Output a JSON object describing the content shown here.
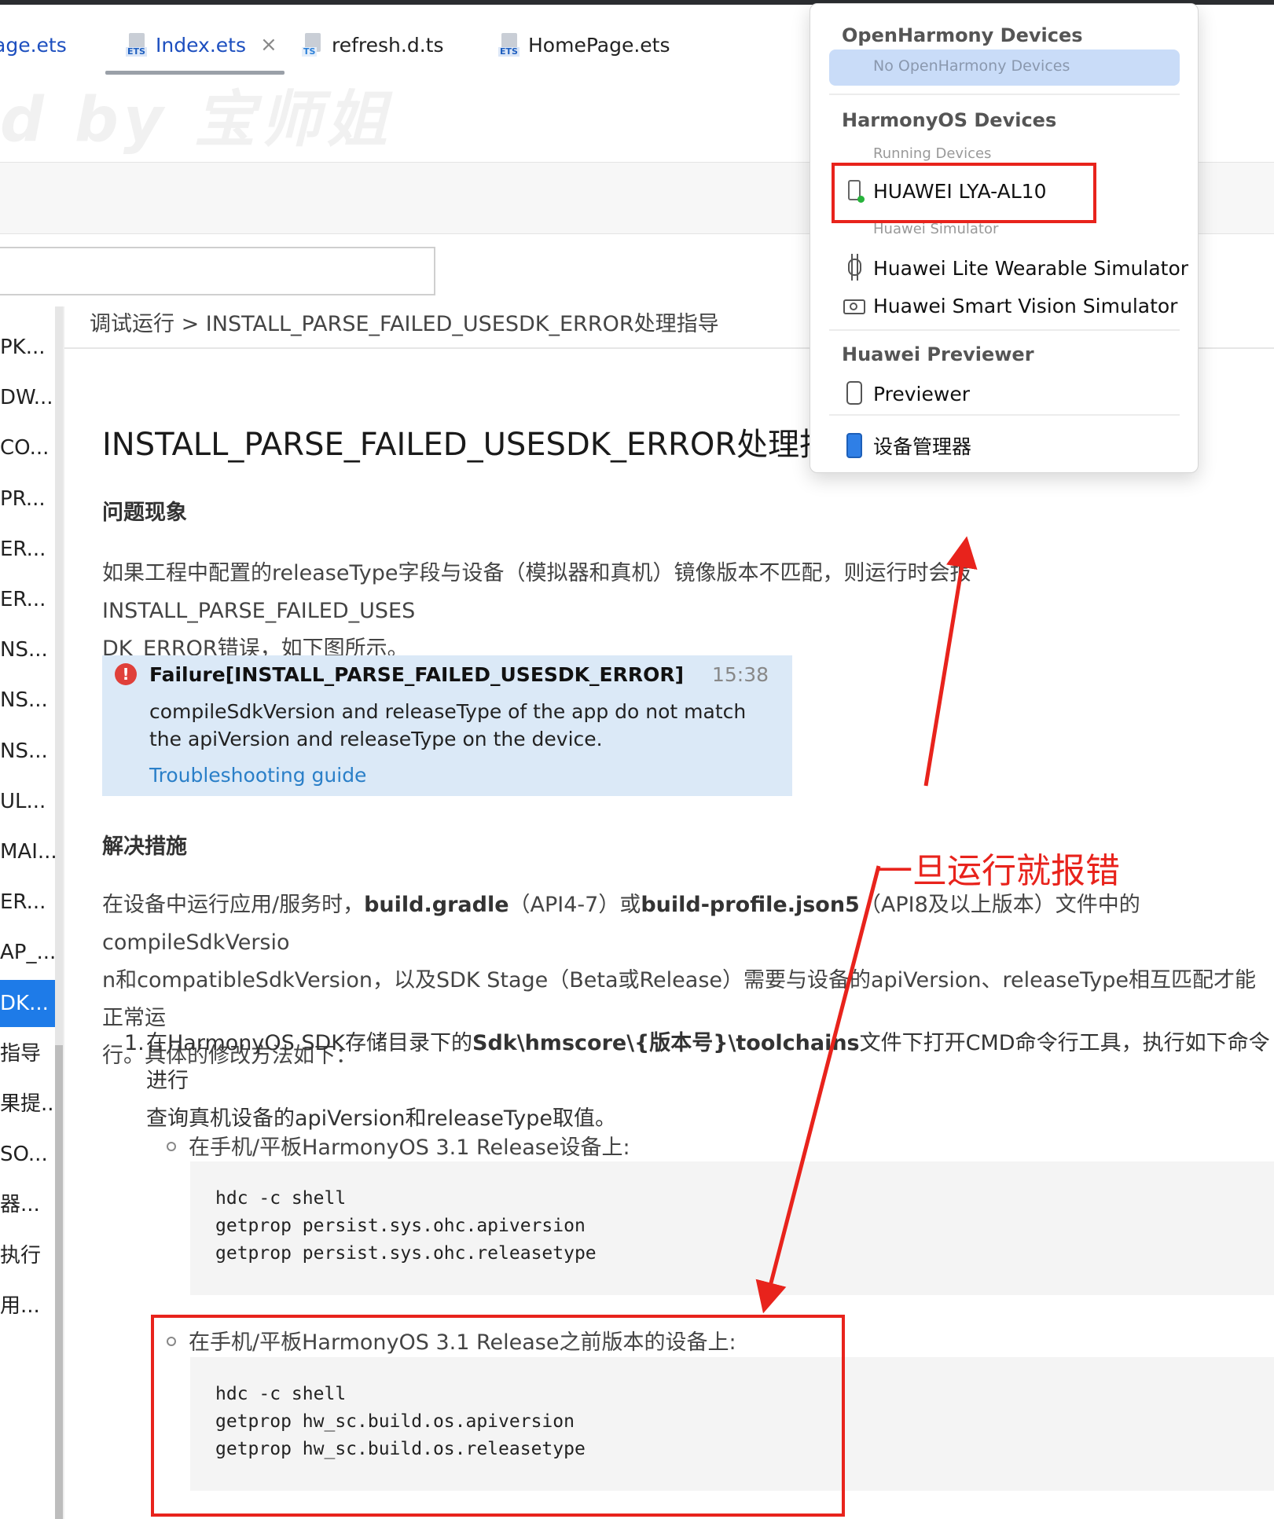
{
  "tabs": [
    {
      "label": "age.ets",
      "type": "ETS"
    },
    {
      "label": "Index.ets",
      "type": "ETS",
      "active": true,
      "close": "×"
    },
    {
      "label": "refresh.d.ts",
      "type": "TS"
    },
    {
      "label": "HomePage.ets",
      "type": "ETS"
    }
  ],
  "watermark": "d by 宝师姐",
  "leftnav": {
    "items": [
      "PK...",
      "DW...",
      "CO...",
      "PR...",
      "ER...",
      "ER...",
      "NS...",
      "NS...",
      "NS...",
      "UL...",
      "MAI...",
      "ER...",
      "AP_...",
      "DK...",
      "指导",
      "果提...",
      "SO...",
      "器...",
      "执行",
      "用..."
    ],
    "selected_index": 13
  },
  "breadcrumb": "调试运行 > INSTALL_PARSE_FAILED_USESDK_ERROR处理指导",
  "article": {
    "title": "INSTALL_PARSE_FAILED_USESDK_ERROR处理指导",
    "section1": "问题现象",
    "para1_line1": "如果工程中配置的releaseType字段与设备（模拟器和真机）镜像版本不匹配，则运行时会报INSTALL_PARSE_FAILED_USES",
    "para1_line2": "DK_ERROR错误，如下图所示。",
    "error": {
      "icon": "!",
      "title": "Failure[INSTALL_PARSE_FAILED_USESDK_ERROR]",
      "time": "15:38",
      "message": "compileSdkVersion and releaseType of the app do not match the apiVersion and releaseType on the device.",
      "link": "Troubleshooting guide"
    },
    "section2": "解决措施",
    "para2": {
      "a": "在设备中运行应用/服务时，",
      "b": "build.gradle",
      "c": "（API4-7）或",
      "d": "build-profile.json5",
      "e": "（API8及以上版本）文件中的compileSdkVersio",
      "line2": "n和compatibleSdkVersion，以及SDK Stage（Beta或Release）需要与设备的apiVersion、releaseType相互匹配才能正常运",
      "line3": "行。具体的修改方法如下："
    },
    "step1": {
      "num": "1.",
      "a": "在HarmonyOS SDK存储目录下的",
      "b": "Sdk\\hmscore\\{版本号}\\toolchains",
      "c": "文件下打开CMD命令行工具，执行如下命令进行",
      "line2": "查询真机设备的apiVersion和releaseType取值。"
    },
    "bullet1": "在手机/平板HarmonyOS 3.1 Release设备上:",
    "code1": [
      "hdc -c shell",
      "getprop persist.sys.ohc.apiversion",
      "getprop persist.sys.ohc.releasetype"
    ],
    "bullet2": "在手机/平板HarmonyOS 3.1 Release之前版本的设备上:",
    "code2": [
      "hdc -c shell",
      "getprop hw_sc.build.os.apiversion",
      "getprop hw_sc.build.os.releasetype"
    ]
  },
  "device_popup": {
    "group1": "OpenHarmony Devices",
    "group1_empty": "No OpenHarmony Devices",
    "group2": "HarmonyOS Devices",
    "running_caption": "Running Devices",
    "running_device": "HUAWEI LYA-AL10",
    "simulator_caption": "Huawei Simulator",
    "sim1": "Huawei Lite Wearable Simulator",
    "sim2": "Huawei Smart Vision Simulator",
    "group3": "Huawei Previewer",
    "previewer": "Previewer",
    "manager": "设备管理器"
  },
  "annotation": {
    "text": "一旦运行就报错",
    "color": "#e8231c"
  },
  "colors": {
    "accent": "#1e7be8",
    "annotation_red": "#e8231c",
    "error_bg": "#dbe9f7",
    "selected_row_bg": "#c9dcf8"
  }
}
